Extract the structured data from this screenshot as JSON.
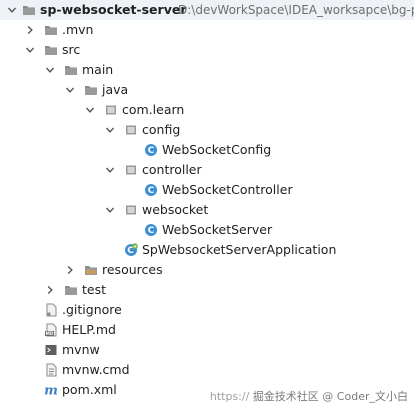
{
  "project": {
    "name": "sp-websocket-server",
    "path": "D:\\devWorkSpace\\IDEA_worksapce\\bg-p"
  },
  "tree": {
    "mvn": ".mvn",
    "src": "src",
    "main": "main",
    "java": "java",
    "package": "com.learn",
    "config": "config",
    "config_class": "WebSocketConfig",
    "controller": "controller",
    "controller_class": "WebSocketController",
    "websocket": "websocket",
    "websocket_class": "WebSocketServer",
    "app_class": "SpWebsocketServerApplication",
    "resources": "resources",
    "test": "test",
    "gitignore": ".gitignore",
    "help": "HELP.md",
    "mvnw": "mvnw",
    "mvnw_cmd": "mvnw.cmd",
    "pom": "pom.xml"
  },
  "watermark": {
    "prefix": "https://",
    "text": "掘金技术社区 @ Coder_文小白"
  },
  "icons": {
    "folder": "folder-icon",
    "package": "package-icon",
    "class": "class-icon",
    "app": "spring-app-icon",
    "resources": "resources-folder-icon",
    "file": "file-icon",
    "markdown": "markdown-icon",
    "script": "script-icon",
    "maven": "maven-icon"
  },
  "colors": {
    "folder": "#8a8a8a",
    "class_badge": "#3d8fd1",
    "spring_green": "#6cb33f",
    "selected_row": "#eef1f6"
  }
}
